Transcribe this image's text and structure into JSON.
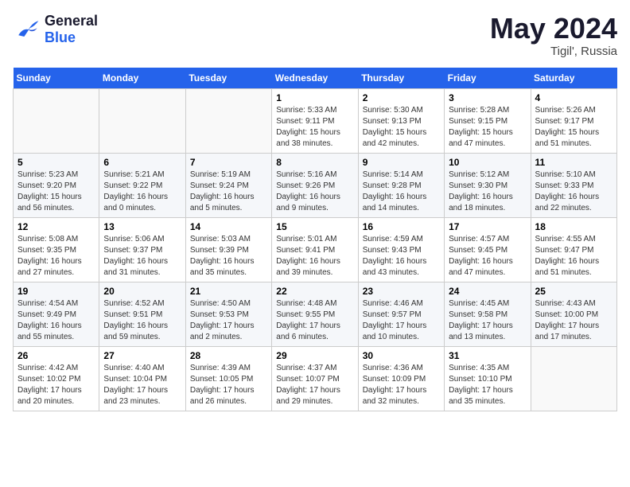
{
  "header": {
    "logo_line1": "General",
    "logo_line2": "Blue",
    "month": "May 2024",
    "location": "Tigil', Russia"
  },
  "weekdays": [
    "Sunday",
    "Monday",
    "Tuesday",
    "Wednesday",
    "Thursday",
    "Friday",
    "Saturday"
  ],
  "weeks": [
    [
      {
        "day": "",
        "info": ""
      },
      {
        "day": "",
        "info": ""
      },
      {
        "day": "",
        "info": ""
      },
      {
        "day": "1",
        "info": "Sunrise: 5:33 AM\nSunset: 9:11 PM\nDaylight: 15 hours\nand 38 minutes."
      },
      {
        "day": "2",
        "info": "Sunrise: 5:30 AM\nSunset: 9:13 PM\nDaylight: 15 hours\nand 42 minutes."
      },
      {
        "day": "3",
        "info": "Sunrise: 5:28 AM\nSunset: 9:15 PM\nDaylight: 15 hours\nand 47 minutes."
      },
      {
        "day": "4",
        "info": "Sunrise: 5:26 AM\nSunset: 9:17 PM\nDaylight: 15 hours\nand 51 minutes."
      }
    ],
    [
      {
        "day": "5",
        "info": "Sunrise: 5:23 AM\nSunset: 9:20 PM\nDaylight: 15 hours\nand 56 minutes."
      },
      {
        "day": "6",
        "info": "Sunrise: 5:21 AM\nSunset: 9:22 PM\nDaylight: 16 hours\nand 0 minutes."
      },
      {
        "day": "7",
        "info": "Sunrise: 5:19 AM\nSunset: 9:24 PM\nDaylight: 16 hours\nand 5 minutes."
      },
      {
        "day": "8",
        "info": "Sunrise: 5:16 AM\nSunset: 9:26 PM\nDaylight: 16 hours\nand 9 minutes."
      },
      {
        "day": "9",
        "info": "Sunrise: 5:14 AM\nSunset: 9:28 PM\nDaylight: 16 hours\nand 14 minutes."
      },
      {
        "day": "10",
        "info": "Sunrise: 5:12 AM\nSunset: 9:30 PM\nDaylight: 16 hours\nand 18 minutes."
      },
      {
        "day": "11",
        "info": "Sunrise: 5:10 AM\nSunset: 9:33 PM\nDaylight: 16 hours\nand 22 minutes."
      }
    ],
    [
      {
        "day": "12",
        "info": "Sunrise: 5:08 AM\nSunset: 9:35 PM\nDaylight: 16 hours\nand 27 minutes."
      },
      {
        "day": "13",
        "info": "Sunrise: 5:06 AM\nSunset: 9:37 PM\nDaylight: 16 hours\nand 31 minutes."
      },
      {
        "day": "14",
        "info": "Sunrise: 5:03 AM\nSunset: 9:39 PM\nDaylight: 16 hours\nand 35 minutes."
      },
      {
        "day": "15",
        "info": "Sunrise: 5:01 AM\nSunset: 9:41 PM\nDaylight: 16 hours\nand 39 minutes."
      },
      {
        "day": "16",
        "info": "Sunrise: 4:59 AM\nSunset: 9:43 PM\nDaylight: 16 hours\nand 43 minutes."
      },
      {
        "day": "17",
        "info": "Sunrise: 4:57 AM\nSunset: 9:45 PM\nDaylight: 16 hours\nand 47 minutes."
      },
      {
        "day": "18",
        "info": "Sunrise: 4:55 AM\nSunset: 9:47 PM\nDaylight: 16 hours\nand 51 minutes."
      }
    ],
    [
      {
        "day": "19",
        "info": "Sunrise: 4:54 AM\nSunset: 9:49 PM\nDaylight: 16 hours\nand 55 minutes."
      },
      {
        "day": "20",
        "info": "Sunrise: 4:52 AM\nSunset: 9:51 PM\nDaylight: 16 hours\nand 59 minutes."
      },
      {
        "day": "21",
        "info": "Sunrise: 4:50 AM\nSunset: 9:53 PM\nDaylight: 17 hours\nand 2 minutes."
      },
      {
        "day": "22",
        "info": "Sunrise: 4:48 AM\nSunset: 9:55 PM\nDaylight: 17 hours\nand 6 minutes."
      },
      {
        "day": "23",
        "info": "Sunrise: 4:46 AM\nSunset: 9:57 PM\nDaylight: 17 hours\nand 10 minutes."
      },
      {
        "day": "24",
        "info": "Sunrise: 4:45 AM\nSunset: 9:58 PM\nDaylight: 17 hours\nand 13 minutes."
      },
      {
        "day": "25",
        "info": "Sunrise: 4:43 AM\nSunset: 10:00 PM\nDaylight: 17 hours\nand 17 minutes."
      }
    ],
    [
      {
        "day": "26",
        "info": "Sunrise: 4:42 AM\nSunset: 10:02 PM\nDaylight: 17 hours\nand 20 minutes."
      },
      {
        "day": "27",
        "info": "Sunrise: 4:40 AM\nSunset: 10:04 PM\nDaylight: 17 hours\nand 23 minutes."
      },
      {
        "day": "28",
        "info": "Sunrise: 4:39 AM\nSunset: 10:05 PM\nDaylight: 17 hours\nand 26 minutes."
      },
      {
        "day": "29",
        "info": "Sunrise: 4:37 AM\nSunset: 10:07 PM\nDaylight: 17 hours\nand 29 minutes."
      },
      {
        "day": "30",
        "info": "Sunrise: 4:36 AM\nSunset: 10:09 PM\nDaylight: 17 hours\nand 32 minutes."
      },
      {
        "day": "31",
        "info": "Sunrise: 4:35 AM\nSunset: 10:10 PM\nDaylight: 17 hours\nand 35 minutes."
      },
      {
        "day": "",
        "info": ""
      }
    ]
  ]
}
